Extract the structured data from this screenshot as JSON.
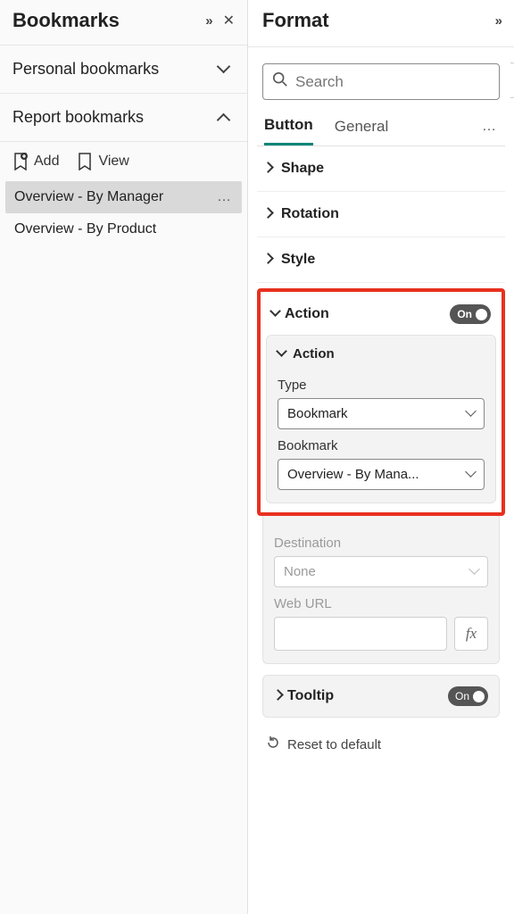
{
  "bookmarks": {
    "title": "Bookmarks",
    "sections": {
      "personal": {
        "label": "Personal bookmarks"
      },
      "report": {
        "label": "Report bookmarks"
      }
    },
    "toolbar": {
      "add": "Add",
      "view": "View"
    },
    "items": [
      {
        "label": "Overview - By Manager",
        "selected": true
      },
      {
        "label": "Overview - By Product",
        "selected": false
      }
    ]
  },
  "format": {
    "title": "Format",
    "search_placeholder": "Search",
    "tabs": {
      "button": "Button",
      "general": "General"
    },
    "groups": {
      "shape": "Shape",
      "rotation": "Rotation",
      "style": "Style",
      "action": "Action",
      "tooltip": "Tooltip"
    },
    "toggle_on": "On",
    "action_card": {
      "header": "Action",
      "type_label": "Type",
      "type_value": "Bookmark",
      "bookmark_label": "Bookmark",
      "bookmark_value": "Overview - By Mana...",
      "destination_label": "Destination",
      "destination_value": "None",
      "weburl_label": "Web URL",
      "fx": "fx"
    },
    "reset": "Reset to default"
  }
}
